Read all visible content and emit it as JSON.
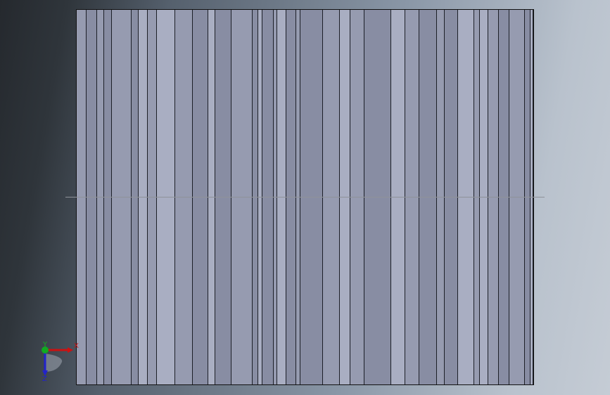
{
  "viewport": {
    "view": "front",
    "model": "ribbed-plate"
  },
  "triad": {
    "x_label": "X",
    "y_label": "Y",
    "z_label": "Z",
    "x_color": "#cc1111",
    "y_color": "#11aa22",
    "z_color": "#2222cc"
  },
  "colors": {
    "light_face": "#a9aec2",
    "mid_face": "#969bb0",
    "dark_face": "#888da3",
    "edge": "#1c1f27",
    "centerline": "#8f9299"
  }
}
